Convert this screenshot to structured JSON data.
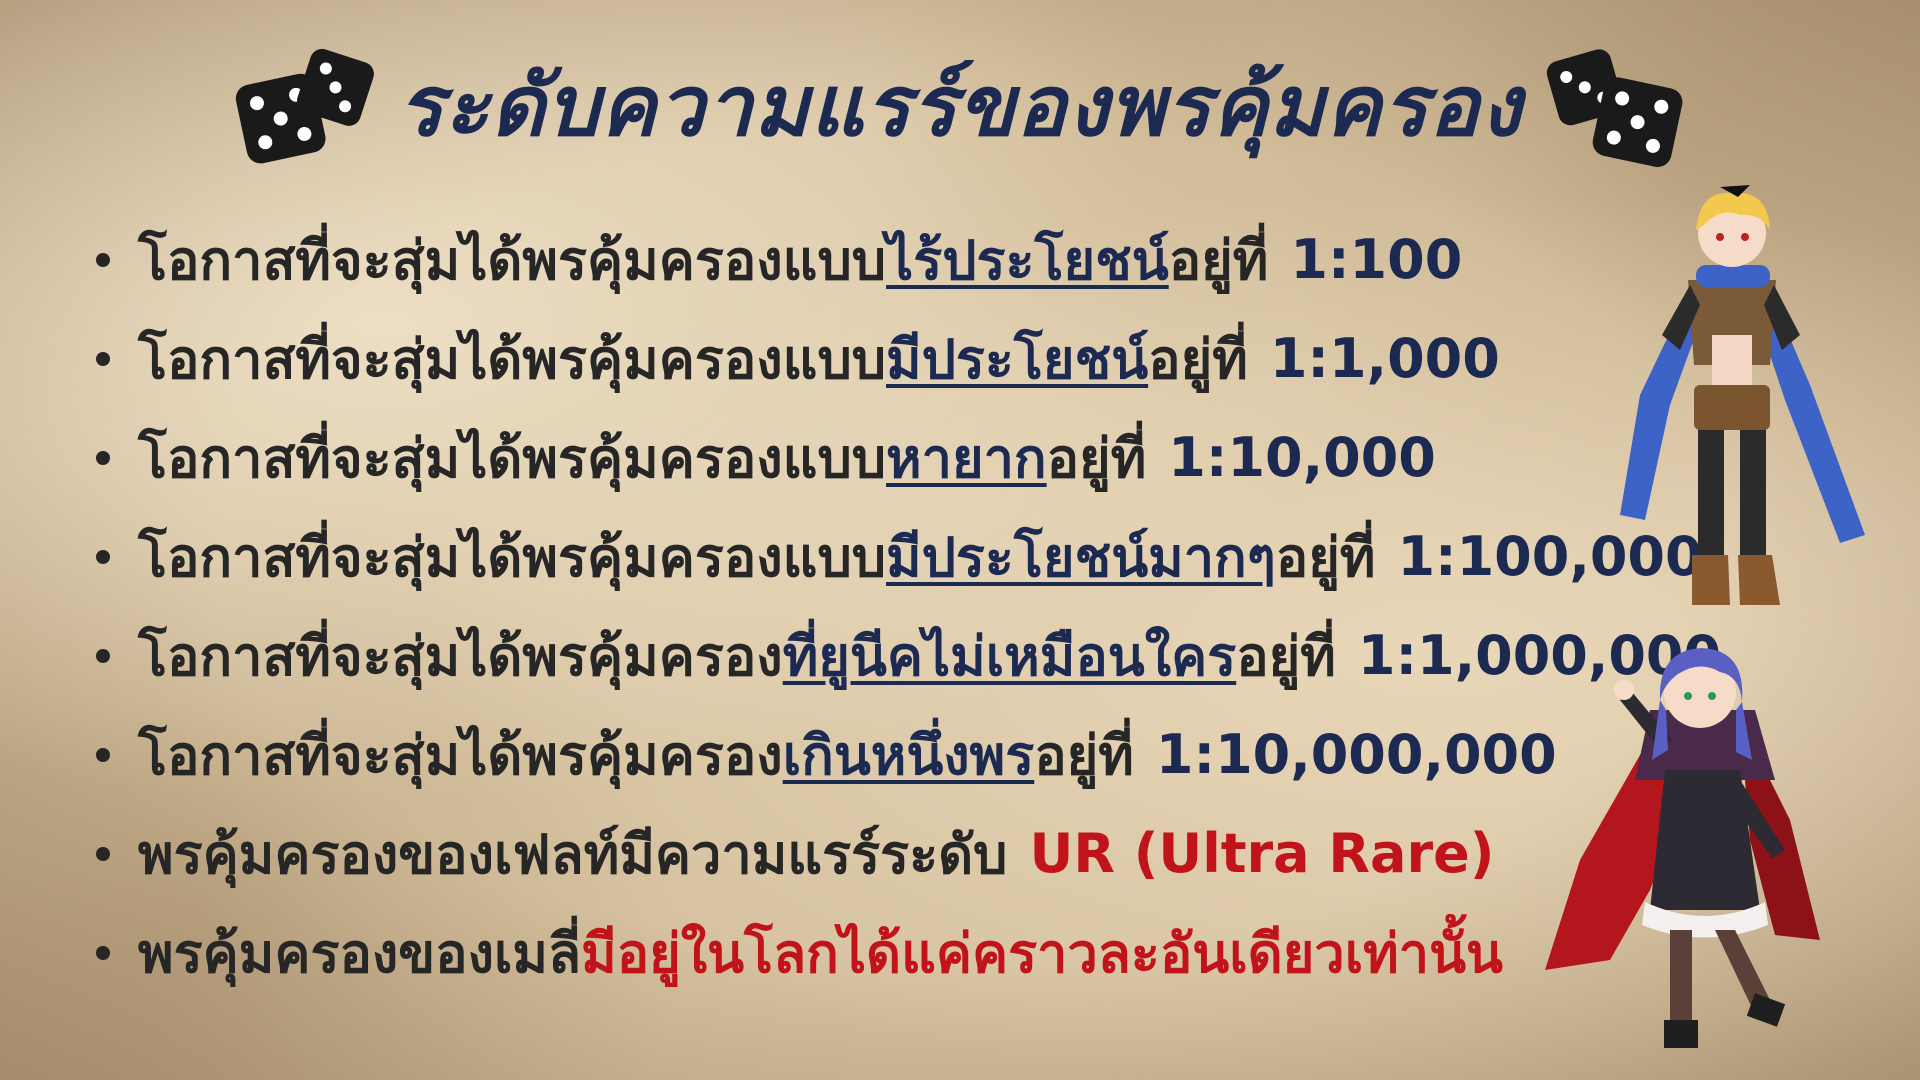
{
  "title": "ระดับความแรร์ของพรคุ้มครอง",
  "items": [
    {
      "prefix": "โอกาสที่จะสุ่มได้พรคุ้มครองแบบ",
      "highlight": "ไร้ประโยชน์",
      "suffix": "อยู่ที่",
      "value": "1:100"
    },
    {
      "prefix": "โอกาสที่จะสุ่มได้พรคุ้มครองแบบ",
      "highlight": "มีประโยชน์",
      "suffix": "อยู่ที่",
      "value": "1:1,000"
    },
    {
      "prefix": "โอกาสที่จะสุ่มได้พรคุ้มครองแบบ",
      "highlight": "หายาก",
      "suffix": "อยู่ที่",
      "value": "1:10,000"
    },
    {
      "prefix": "โอกาสที่จะสุ่มได้พรคุ้มครองแบบ",
      "highlight": "มีประโยชน์มากๆ",
      "suffix": " อยู่ที่",
      "value": "1:100,000"
    },
    {
      "prefix": "โอกาสที่จะสุ่มได้พรคุ้มครอง",
      "highlight": "ที่ยูนีคไม่เหมือนใคร",
      "suffix": "อยู่ที่",
      "value": "1:1,000,000"
    },
    {
      "prefix": "โอกาสที่จะสุ่มได้พรคุ้มครอง",
      "highlight": "เกินหนึ่งพร",
      "suffix": "อยู่ที่",
      "value": "1:10,000,000"
    }
  ],
  "fell_note": {
    "text": "พรคุ้มครองของเฟลท์มีความแรร์ระดับ",
    "value": "UR (Ultra Rare)"
  },
  "emilia_note": {
    "text": "พรคุ้มครองของเมลี่",
    "highlight": "มีอยู่ในโลกได้แค่คราวละอันเดียวเท่านั้น"
  },
  "colors": {
    "title": "#1c2a52",
    "text": "#262626",
    "highlight": "#1c2a52",
    "accent": "#c0141a",
    "background": "#d6c2a0"
  },
  "icons": [
    "dice-icon",
    "dice-icon"
  ],
  "characters": [
    "blonde-girl-character",
    "purple-hair-girl-character"
  ]
}
